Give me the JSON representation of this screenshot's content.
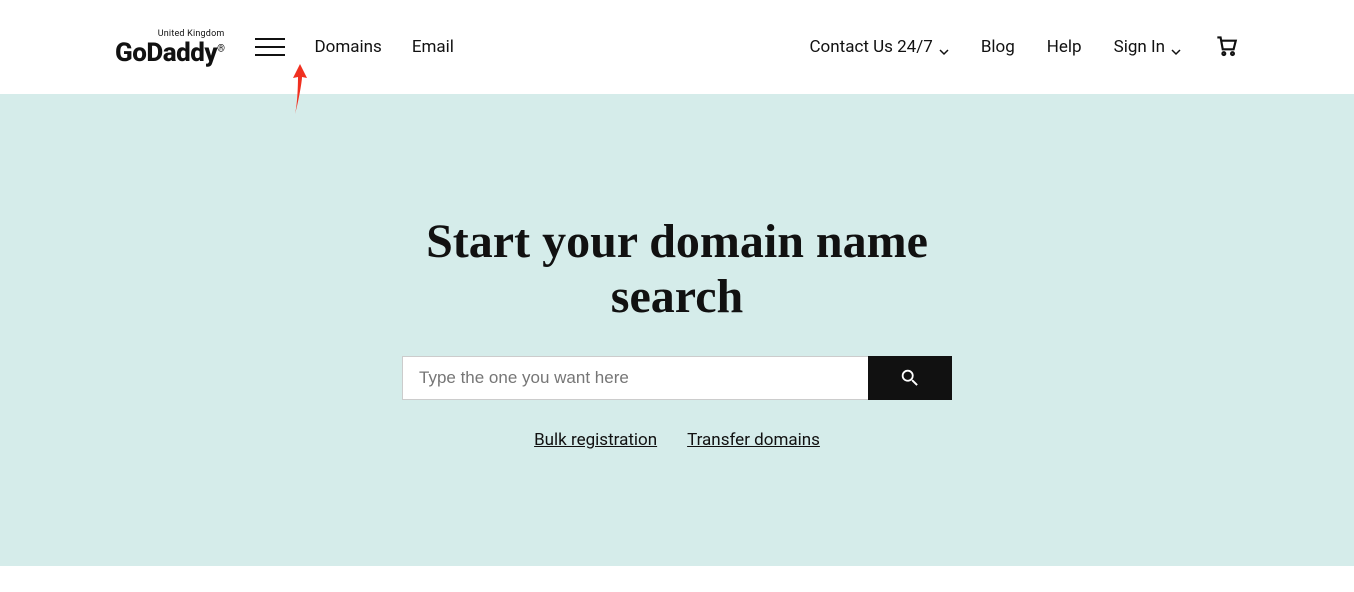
{
  "header": {
    "logo_region": "United Kingdom",
    "logo_text": "GoDaddy",
    "nav": {
      "domains": "Domains",
      "email": "Email"
    },
    "right": {
      "contact": "Contact Us 24/7",
      "blog": "Blog",
      "help": "Help",
      "signin": "Sign In"
    }
  },
  "hero": {
    "title": "Start your domain name search",
    "search_placeholder": "Type the one you want here",
    "links": {
      "bulk": "Bulk registration",
      "transfer": "Transfer domains"
    }
  }
}
